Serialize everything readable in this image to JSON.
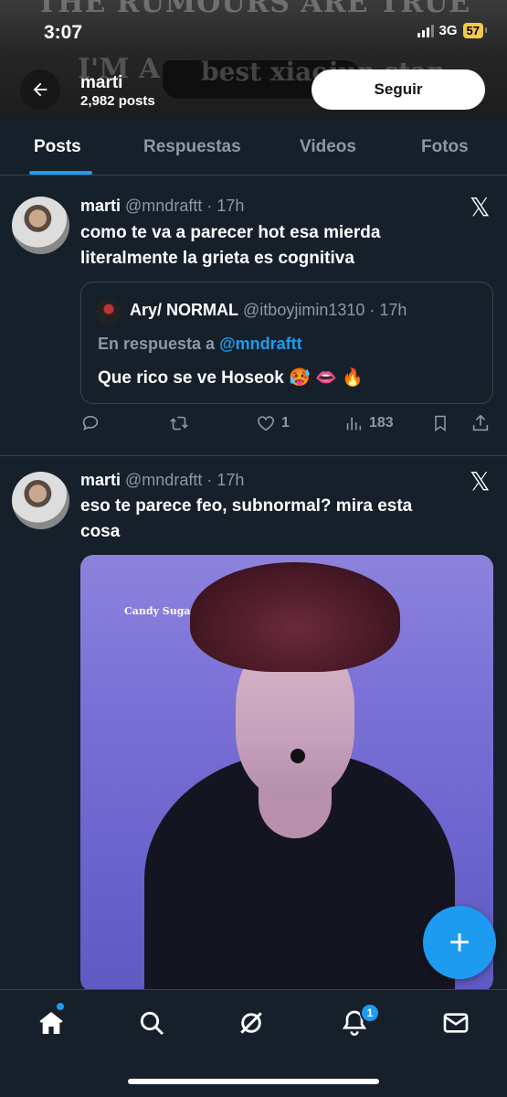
{
  "status_bar": {
    "time": "3:07",
    "network": "3G",
    "battery": "57"
  },
  "banner": {
    "top_text": "THE RUMOURS ARE TRUE",
    "mid_text_left": "I'M A",
    "mid_text_right": "best xiaojun stan"
  },
  "header": {
    "name": "marti",
    "posts_count": "2,982 posts",
    "follow_label": "Seguir"
  },
  "tabs": [
    {
      "label": "Posts",
      "active": true
    },
    {
      "label": "Respuestas",
      "active": false
    },
    {
      "label": "Videos",
      "active": false
    },
    {
      "label": "Fotos",
      "active": false
    }
  ],
  "posts": [
    {
      "name": "marti",
      "handle": "@mndraftt · 17h",
      "text_line1": "como te va a parecer hot esa mierda",
      "text_line2": "literalmente la grieta es cognitiva",
      "quote": {
        "name": "Ary/ NORMAL",
        "handle": "@itboyjimin1310 · 17h",
        "reply_prefix": "En respuesta a",
        "reply_mention": "@mndraftt",
        "text": "Que rico se ve Hoseok 🥵 👄 🔥"
      },
      "likes": "1",
      "views": "183"
    },
    {
      "name": "marti",
      "handle": "@mndraftt · 17h",
      "text_line1": "eso te parece feo, subnormal? mira esta",
      "text_line2": "cosa",
      "media_watermark": "Candy Suga"
    }
  ],
  "colors": {
    "accent": "#1d9bf0",
    "background": "#15202b",
    "muted": "#8b98a5",
    "border": "#38444d"
  },
  "nav": {
    "notifications_badge": "1"
  }
}
